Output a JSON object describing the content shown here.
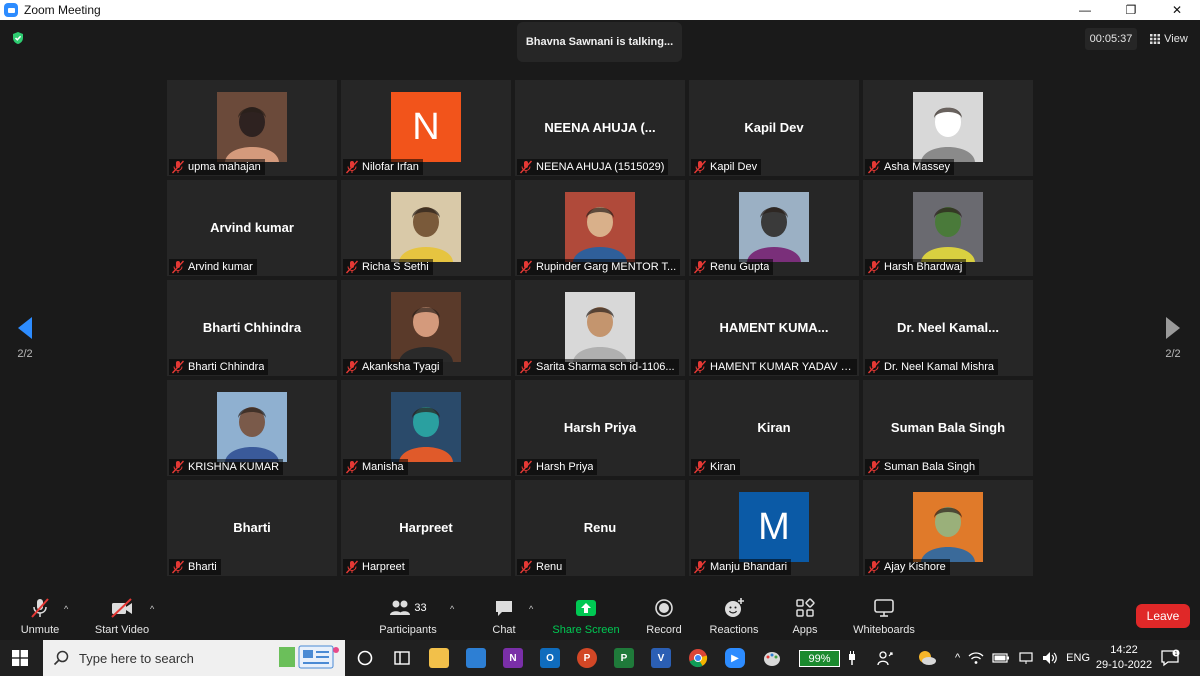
{
  "window": {
    "title": "Zoom Meeting"
  },
  "meeting": {
    "talking_text": "Bhavna Sawnani is talking...",
    "timer": "00:05:37",
    "view_label": "View",
    "page_indicator_left": "2/2",
    "page_indicator_right": "2/2"
  },
  "participants": [
    {
      "display": "",
      "tag": "upma mahajan",
      "avatar": "photo",
      "photo_colors": [
        "#6b4a3a",
        "#d49a7c",
        "#2e2220"
      ]
    },
    {
      "display": "",
      "tag": "Nilofar Irfan",
      "avatar": "letter",
      "letter": "N",
      "letter_bg": "#f2541b"
    },
    {
      "display": "NEENA AHUJA (...",
      "tag": "NEENA AHUJA (1515029)",
      "avatar": "none"
    },
    {
      "display": "Kapil Dev",
      "tag": "Kapil Dev",
      "avatar": "none"
    },
    {
      "display": "",
      "tag": "Asha Massey",
      "avatar": "photo",
      "photo_colors": [
        "#d8d8d8",
        "#8a8a8a",
        "#ffffff"
      ]
    },
    {
      "display": "Arvind kumar",
      "tag": "Arvind kumar",
      "avatar": "none"
    },
    {
      "display": "",
      "tag": "Richa S Sethi",
      "avatar": "photo",
      "photo_colors": [
        "#d9c9a8",
        "#e6c440",
        "#7a5a3a"
      ]
    },
    {
      "display": "",
      "tag": "Rupinder Garg MENTOR T...",
      "avatar": "photo",
      "photo_colors": [
        "#b04a3a",
        "#2f5f9a",
        "#d9b08a"
      ]
    },
    {
      "display": "",
      "tag": "Renu Gupta",
      "avatar": "photo",
      "photo_colors": [
        "#9bb0c4",
        "#7a2f7a",
        "#3a3a3a"
      ]
    },
    {
      "display": "",
      "tag": "Harsh Bhardwaj",
      "avatar": "photo",
      "photo_colors": [
        "#6a6a70",
        "#d9d040",
        "#4a7a3a"
      ]
    },
    {
      "display": "Bharti Chhindra",
      "tag": "Bharti Chhindra",
      "avatar": "none"
    },
    {
      "display": "",
      "tag": "Akanksha Tyagi",
      "avatar": "photo",
      "photo_colors": [
        "#5a3a2a",
        "#2a2a2a",
        "#d49a7c"
      ]
    },
    {
      "display": "",
      "tag": "Sarita Sharma sch id-1106...",
      "avatar": "photo",
      "photo_colors": [
        "#d8d8d8",
        "#b0b0b0",
        "#c4956e"
      ]
    },
    {
      "display": "HAMENT  KUMA...",
      "tag": "HAMENT KUMAR YADAV (...",
      "avatar": "none"
    },
    {
      "display": "Dr. Neel Kamal...",
      "tag": "Dr. Neel Kamal Mishra",
      "avatar": "none"
    },
    {
      "display": "",
      "tag": "KRISHNA KUMAR",
      "avatar": "photo",
      "photo_colors": [
        "#8fb0d0",
        "#3a5a9a",
        "#7a5a4a"
      ]
    },
    {
      "display": "",
      "tag": "Manisha",
      "avatar": "photo",
      "photo_colors": [
        "#2a4a6a",
        "#e05a2a",
        "#2aa0a0"
      ]
    },
    {
      "display": "Harsh Priya",
      "tag": "Harsh Priya",
      "avatar": "none"
    },
    {
      "display": "Kiran",
      "tag": "Kiran",
      "avatar": "none"
    },
    {
      "display": "Suman Bala Singh",
      "tag": "Suman Bala Singh",
      "avatar": "none"
    },
    {
      "display": "Bharti",
      "tag": "Bharti",
      "avatar": "none"
    },
    {
      "display": "Harpreet",
      "tag": "Harpreet",
      "avatar": "none"
    },
    {
      "display": "Renu",
      "tag": "Renu",
      "avatar": "none"
    },
    {
      "display": "",
      "tag": "Manju Bhandari",
      "avatar": "letter",
      "letter": "M",
      "letter_bg": "#0b5aa6"
    },
    {
      "display": "",
      "tag": "Ajay Kishore",
      "avatar": "photo",
      "photo_colors": [
        "#e07a2a",
        "#3a6a9a",
        "#9ab07a"
      ]
    }
  ],
  "toolbar": {
    "unmute": "Unmute",
    "start_video": "Start Video",
    "participants": "Participants",
    "participants_count": "33",
    "chat": "Chat",
    "share_screen": "Share Screen",
    "record": "Record",
    "reactions": "Reactions",
    "apps": "Apps",
    "whiteboards": "Whiteboards",
    "leave": "Leave"
  },
  "taskbar": {
    "search_placeholder": "Type here to search",
    "battery": "99%",
    "language": "ENG",
    "time": "14:22",
    "date": "29-10-2022"
  },
  "colors": {
    "accent_blue": "#2d8cff",
    "leave_red": "#e02828",
    "share_green": "#00c853",
    "mute_red": "#e53935",
    "tile_bg": "#262626"
  }
}
